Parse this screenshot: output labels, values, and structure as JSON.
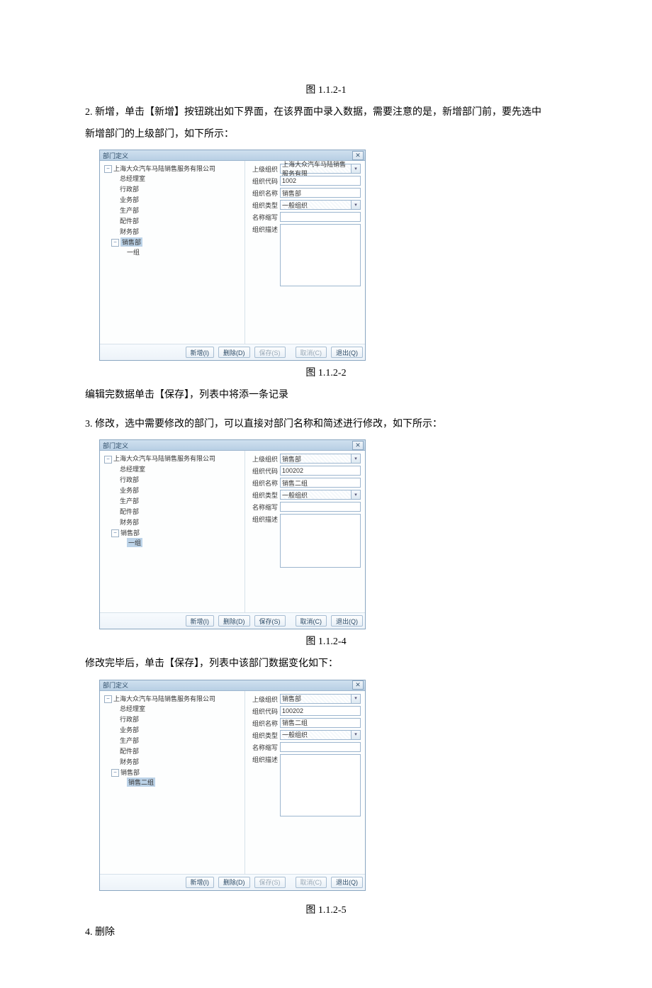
{
  "captions": {
    "c1": "图 1.1.2-1",
    "c2": "图 1.1.2-2",
    "c4": "图 1.1.2-4",
    "c5": "图 1.1.2-5"
  },
  "paras": {
    "p2a": "2. 新增，单击【新增】按钮跳出如下界面，在该界面中录入数据，需要注意的是，新增部门前，要先选中",
    "p2b": "新增部门的上级部门，如下所示：",
    "p2c": "编辑完数据单击【保存】，列表中将添一条记录",
    "p3a": "3. 修改，选中需要修改的部门，可以直接对部门名称和简述进行修改，如下所示：",
    "p3b": "修改完毕后，单击【保存】，列表中该部门数据变化如下：",
    "p4": "4. 删除"
  },
  "dlgA": {
    "title": "部门定义",
    "tree": {
      "root": "上海大众汽车马陆销售服务有限公司",
      "items": [
        "总经理室",
        "行政部",
        "业务部",
        "生产部",
        "配件部",
        "财务部",
        "销售部"
      ],
      "sales_child": "一组",
      "selected": "销售部"
    },
    "form": {
      "f1_label": "上级组织",
      "f1_value": "上海大众汽车马陆销售服务有限",
      "f2_label": "组织代码",
      "f2_value": "1002",
      "f3_label": "组织名称",
      "f3_value": "销售部",
      "f4_label": "组织类型",
      "f4_value": "一般组织",
      "f5_label": "名称缩写",
      "f5_value": "",
      "f6_label": "组织描述",
      "f6_value": ""
    },
    "buttons": {
      "add": "新增(I)",
      "del": "删除(D)",
      "save": "保存(S)",
      "cancel": "取消(C)",
      "exit": "退出(Q)"
    }
  },
  "dlgB": {
    "title": "部门定义",
    "tree": {
      "root": "上海大众汽车马陆销售服务有限公司",
      "items": [
        "总经理室",
        "行政部",
        "业务部",
        "生产部",
        "配件部",
        "财务部",
        "销售部"
      ],
      "sales_child": "一组",
      "selected": "一组"
    },
    "form": {
      "f1_label": "上级组织",
      "f1_value": "销售部",
      "f2_label": "组织代码",
      "f2_value": "100202",
      "f3_label": "组织名称",
      "f3_value": "销售二组",
      "f4_label": "组织类型",
      "f4_value": "一般组织",
      "f5_label": "名称缩写",
      "f5_value": "",
      "f6_label": "组织描述",
      "f6_value": ""
    },
    "buttons": {
      "add": "新增(I)",
      "del": "删除(D)",
      "save": "保存(S)",
      "cancel": "取消(C)",
      "exit": "退出(Q)"
    }
  },
  "dlgC": {
    "title": "部门定义",
    "tree": {
      "root": "上海大众汽车马陆销售服务有限公司",
      "items": [
        "总经理室",
        "行政部",
        "业务部",
        "生产部",
        "配件部",
        "财务部",
        "销售部"
      ],
      "sales_child": "销售二组",
      "selected": "销售二组"
    },
    "form": {
      "f1_label": "上级组织",
      "f1_value": "销售部",
      "f2_label": "组织代码",
      "f2_value": "100202",
      "f3_label": "组织名称",
      "f3_value": "销售二组",
      "f4_label": "组织类型",
      "f4_value": "一般组织",
      "f5_label": "名称缩写",
      "f5_value": "",
      "f6_label": "组织描述",
      "f6_value": ""
    },
    "buttons": {
      "add": "新增(I)",
      "del": "删除(D)",
      "save": "保存(S)",
      "cancel": "取消(C)",
      "exit": "退出(Q)"
    }
  }
}
